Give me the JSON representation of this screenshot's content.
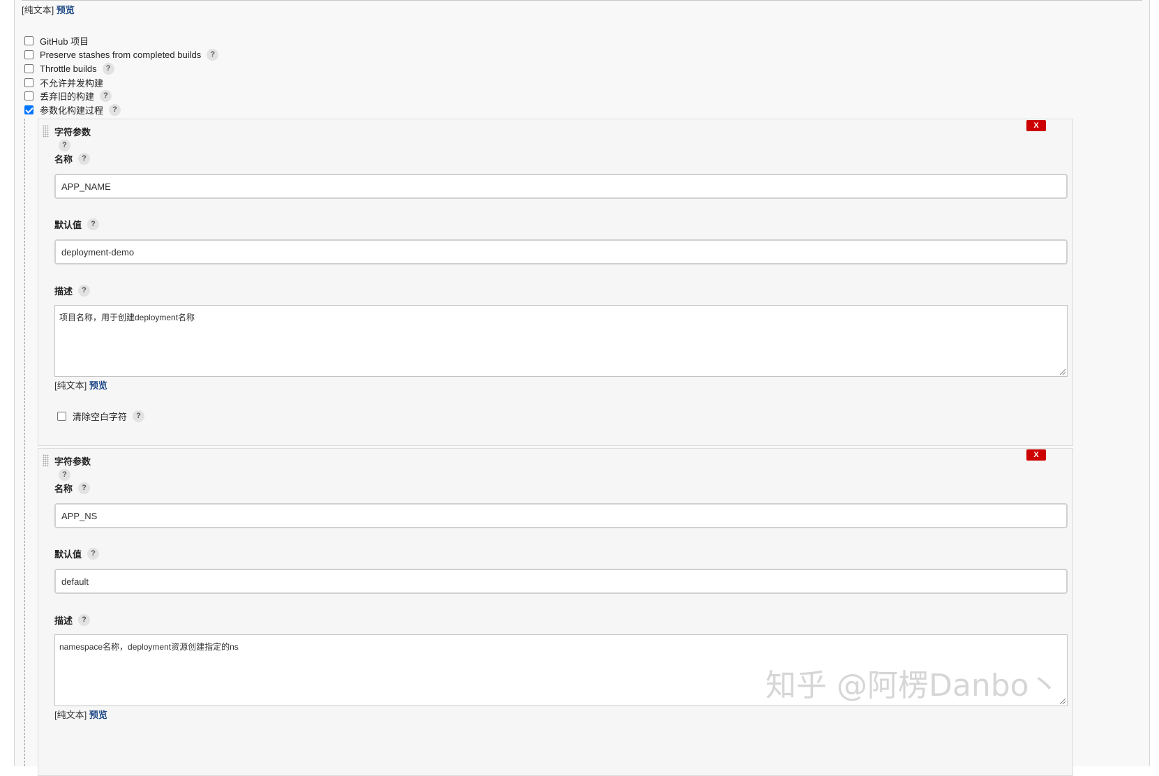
{
  "top_preview": {
    "plain": "[纯文本]",
    "preview": "预览"
  },
  "options": [
    {
      "label": "GitHub 项目",
      "checked": false,
      "help": false
    },
    {
      "label": "Preserve stashes from completed builds",
      "checked": false,
      "help": true
    },
    {
      "label": "Throttle builds",
      "checked": false,
      "help": true
    },
    {
      "label": "不允许并发构建",
      "checked": false,
      "help": false
    },
    {
      "label": "丢弃旧的构建",
      "checked": false,
      "help": true
    },
    {
      "label": "参数化构建过程",
      "checked": true,
      "help": true
    }
  ],
  "help_glyph": "?",
  "params": [
    {
      "title": "字符参数",
      "delete_label": "X",
      "name_label": "名称",
      "name_value": "APP_NAME",
      "default_label": "默认值",
      "default_value": "deployment-demo",
      "desc_label": "描述",
      "desc_value": "项目名称，用于创建deployment名称",
      "plain": "[纯文本]",
      "preview": "预览",
      "trim_label": "清除空白字符"
    },
    {
      "title": "字符参数",
      "delete_label": "X",
      "name_label": "名称",
      "name_value": "APP_NS",
      "default_label": "默认值",
      "default_value": "default",
      "desc_label": "描述",
      "desc_value": "namespace名称，deployment资源创建指定的ns",
      "plain": "[纯文本]",
      "preview": "预览"
    }
  ],
  "watermark": "知乎 @阿楞Danbo丶"
}
